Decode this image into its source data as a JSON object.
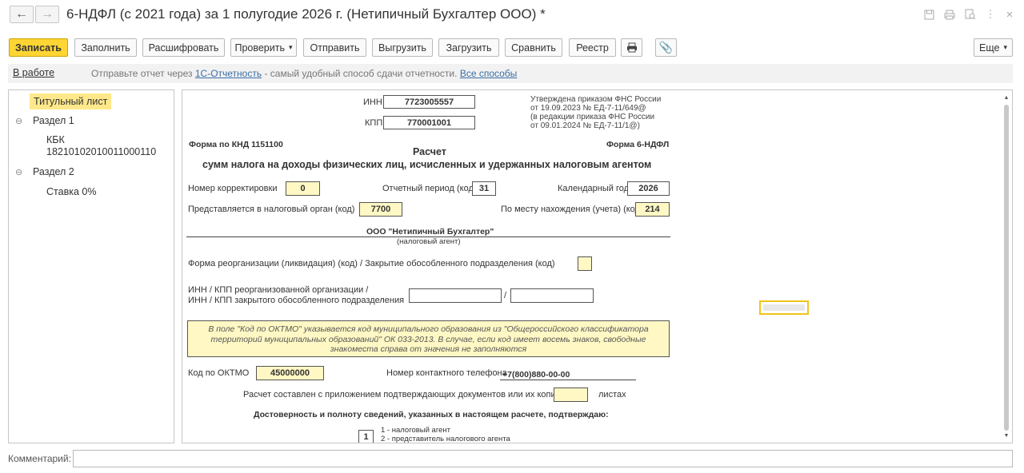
{
  "window": {
    "title": "6-НДФЛ (с 2021 года) за 1 полугодие 2026 г. (Нетипичный Бухгалтер ООО) *",
    "back_icon": "arrow-left-icon",
    "forward_icon": "arrow-right-icon",
    "title_icons": [
      "save-icon",
      "print-icon",
      "preview-icon",
      "more-vertical-icon",
      "close-icon"
    ]
  },
  "toolbar": {
    "save_label": "Записать",
    "fill_label": "Заполнить",
    "decode_label": "Расшифровать",
    "check_label": "Проверить",
    "send_label": "Отправить",
    "export_label": "Выгрузить",
    "import_label": "Загрузить",
    "compare_label": "Сравнить",
    "registry_label": "Реестр",
    "more_label": "Еще",
    "print_icon": "printer-icon",
    "attach_icon": "paperclip-icon"
  },
  "infobar": {
    "status_link": "В работе",
    "text_before": "Отправьте отчет через",
    "link_1c": "1С-Отчетность",
    "text_after": "- самый удобный способ сдачи отчетности.",
    "all_ways_link": "Все способы"
  },
  "tree": {
    "title_sheet": "Титульный лист",
    "section1": "Раздел 1",
    "kbk_label": "КБК",
    "kbk_value": "18210102010011000110",
    "section2": "Раздел 2",
    "rate": "Ставка 0%"
  },
  "form": {
    "inn_label": "ИНН",
    "inn_value": "7723005557",
    "kpp_label": "КПП",
    "kpp_value": "770001001",
    "approval_1": "Утверждена приказом ФНС России",
    "approval_2": "от 19.09.2023 № ЕД-7-11/649@",
    "approval_3": "(в редакции приказа ФНС России",
    "approval_4": "от 09.01.2024 № ЕД-7-11/1@)",
    "knd": "Форма по КНД 1151100",
    "form_code": "Форма 6-НДФЛ",
    "heading": "Расчет",
    "subheading": "сумм налога на доходы физических лиц, исчисленных и удержанных налоговым агентом",
    "correction_label": "Номер корректировки",
    "correction_value": "0",
    "period_label": "Отчетный период (код)",
    "period_value": "31",
    "year_label": "Календарный год",
    "year_value": "2026",
    "tax_org_label": "Представляется в налоговый орган (код)",
    "tax_org_value": "7700",
    "location_label": "По месту нахождения (учета) (код)",
    "location_value": "214",
    "org_name": "ООО \"Нетипичный Бухгалтер\"",
    "org_caption": "(налоговый агент)",
    "reorg_label": "Форма реорганизации (ликвидация) (код) / Закрытие обособленного подразделения (код)",
    "reorg_value": "",
    "inn_kpp_reorg_1": "ИНН / КПП реорганизованной организации /",
    "inn_kpp_reorg_2": "ИНН / КПП закрытого обособленного подразделения",
    "slash": "/",
    "note_1": "В поле \"Код по ОКТМО\" указывается код муниципального образования из \"Общероссийского классификатора",
    "note_2": "территорий муниципальных образований\" ОК 033-2013. В случае, если код имеет восемь знаков, свободные",
    "note_3": "знакоместа справа от значения не заполняются",
    "oktmo_label": "Код по ОКТМО",
    "oktmo_value": "45000000",
    "phone_label": "Номер контактного телефона",
    "phone_value": "+7(800)880-00-00",
    "attached_label": "Расчет составлен с приложением подтверждающих документов или их копий на",
    "attached_value": "",
    "sheets_label": "листах",
    "confirm_heading": "Достоверность и полноту сведений, указанных в настоящем расчете, подтверждаю:",
    "signer_value": "1",
    "signer_opt1": "1 - налоговый агент",
    "signer_opt2": "2 - представитель налогового агента"
  },
  "comment": {
    "label": "Комментарий:",
    "value": ""
  },
  "colors": {
    "accent_yellow": "#ffd533",
    "field_yellow": "#fff8c4",
    "link_blue": "#3a6ea5"
  }
}
